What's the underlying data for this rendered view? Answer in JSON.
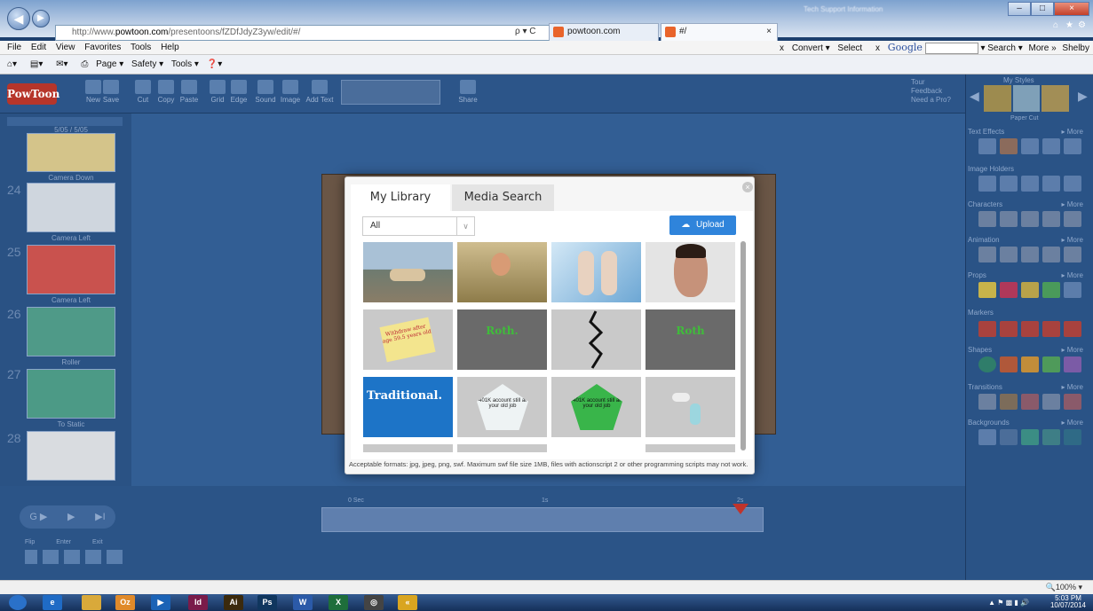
{
  "browser": {
    "address_prefix": "http://www.",
    "address_host": "powtoon.com",
    "address_path": "/presentoons/fZDfJdyZ3yw/edit/#/",
    "address_controls": "ρ ▾ C",
    "tab_powtoon": "powtoon.com",
    "tab_second": "#/",
    "tab_close": "×",
    "tab_right_title": "Tech Support Information",
    "win_min": "–",
    "win_max": "□",
    "win_close": "×",
    "home_icon": "home-icon",
    "star_icon": "star-icon",
    "menu": [
      "File",
      "Edit",
      "View",
      "Favorites",
      "Tools",
      "Help"
    ],
    "cmd": [
      "▾",
      "▾",
      "▾",
      "Page ▾",
      "Safety ▾",
      "Tools ▾",
      "▾"
    ],
    "right_menu": {
      "close": "x",
      "convert": "Convert ▾",
      "select": "Select",
      "close2": "x",
      "google": "Google",
      "search": "▾ Search ▾",
      "more": "More »",
      "user": "Shelby"
    }
  },
  "app": {
    "logo": "PowToon",
    "toolbar": [
      "New",
      "Save",
      "Cut",
      "Copy",
      "Paste",
      "Grid",
      "Edge",
      "Sound",
      "Image",
      "Add Text",
      "Share"
    ],
    "help_links": [
      "Tour",
      "Feedback",
      "Need a Pro?"
    ],
    "slides": [
      {
        "num": "",
        "caption": "Camera Down",
        "color": "#d4c48a"
      },
      {
        "num": "24",
        "caption": "Camera Left",
        "color": "#cfd6de"
      },
      {
        "num": "25",
        "caption": "Camera Left",
        "color": "#c9524e"
      },
      {
        "num": "26",
        "caption": "Roller",
        "color": "#4f9a88"
      },
      {
        "num": "27",
        "caption": "To Static",
        "color": "#4c9a86"
      },
      {
        "num": "28",
        "caption": "",
        "color": "#d9dce0"
      }
    ],
    "slide_top_caption": "5/05 / 5/05",
    "timeline": {
      "start": "0 Sec",
      "mid": "1s",
      "end": "2s"
    },
    "player": {
      "rewind": "G ▶",
      "play": "▶",
      "next": "▶I"
    },
    "bottom_labels": [
      "Flip",
      "Enter",
      "Exit"
    ]
  },
  "styles_panel": {
    "title": "My Styles",
    "style_caption": "Paper Cut",
    "sections": [
      {
        "name": "Text Effects",
        "more": "▸ More"
      },
      {
        "name": "Image Holders",
        "more": ""
      },
      {
        "name": "Characters",
        "more": "▸ More"
      },
      {
        "name": "Animation",
        "more": "▸ More"
      },
      {
        "name": "Props",
        "more": "▸ More"
      },
      {
        "name": "Markers",
        "more": ""
      },
      {
        "name": "Shapes",
        "more": "▸ More"
      },
      {
        "name": "Transitions",
        "more": "▸ More"
      },
      {
        "name": "Backgrounds",
        "more": "▸ More"
      }
    ]
  },
  "modal": {
    "tab_library": "My Library",
    "tab_search": "Media Search",
    "filter_value": "All",
    "filter_chevron": "∨",
    "upload_label": "Upload",
    "close": "×",
    "images": [
      {
        "label": "",
        "bg": "#8fa9b8"
      },
      {
        "label": "",
        "bg": "#b9a47a"
      },
      {
        "label": "",
        "bg": "#9cc6e6"
      },
      {
        "label": "",
        "bg": "#d8d8d8"
      },
      {
        "label": "Withdraw after age 59.5 years old",
        "bg": "#c9c9c9"
      },
      {
        "label": "Roth.",
        "bg": "#6a6a6a"
      },
      {
        "label": "",
        "bg": "#c9c9c9"
      },
      {
        "label": "Roth",
        "bg": "#6a6a6a"
      },
      {
        "label": "Traditional.",
        "bg": "#1d74c7"
      },
      {
        "label": "401K account still at your old job",
        "bg": "#c9c9c9"
      },
      {
        "label": "401K account still at your old job",
        "bg": "#c9c9c9"
      },
      {
        "label": "",
        "bg": "#c9c9c9"
      }
    ],
    "note": "Acceptable formats: jpg, jpeg, png, swf. Maximum swf file size 1MB, files with actionscript 2 or other programming scripts may not work."
  },
  "status": {
    "zoom": "100%"
  },
  "taskbar": {
    "apps": [
      {
        "label": "",
        "color": "#2a71c9"
      },
      {
        "label": "e",
        "color": "#1f6bc5"
      },
      {
        "label": "",
        "color": "#d9a93a"
      },
      {
        "label": "Oz",
        "color": "#e08a2a"
      },
      {
        "label": "▶",
        "color": "#1b63b6"
      },
      {
        "label": "Id",
        "color": "#7a1b4a"
      },
      {
        "label": "Ai",
        "color": "#3b2a0d"
      },
      {
        "label": "Ps",
        "color": "#10365e"
      },
      {
        "label": "W",
        "color": "#2b5aa8"
      },
      {
        "label": "X",
        "color": "#1e6e3b"
      },
      {
        "label": "◎",
        "color": "#444"
      },
      {
        "label": "«",
        "color": "#d9a520"
      }
    ],
    "time": "5:03 PM",
    "date": "10/07/2014"
  }
}
